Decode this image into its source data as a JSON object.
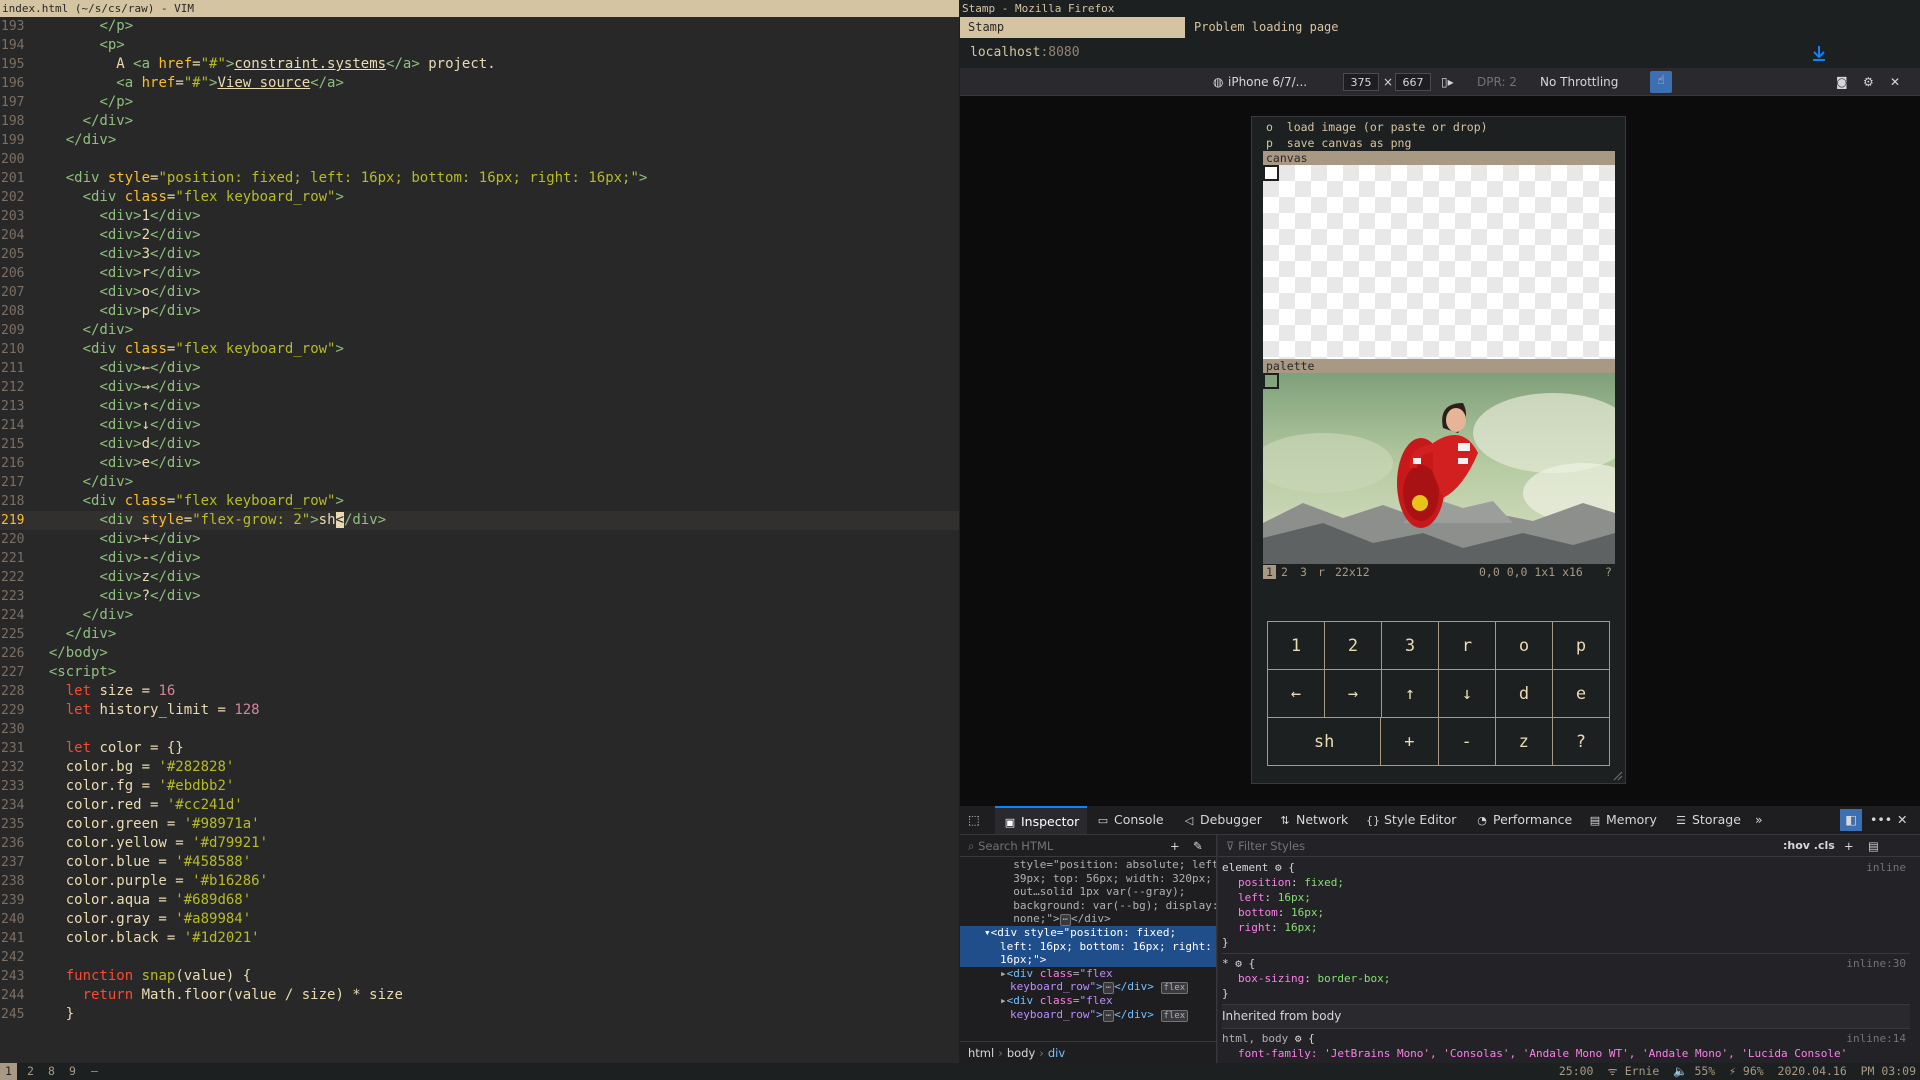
{
  "vim": {
    "title": "index.html (~/s/cs/raw) - VIM"
  },
  "firefox": {
    "title": "Stamp - Mozilla Firefox",
    "tabs": [
      {
        "label": "Stamp"
      },
      {
        "label": "Problem loading page"
      }
    ],
    "url_host": "localhost",
    "url_port": ":8080",
    "rdm": {
      "device": "iPhone 6/7/...",
      "width": "375",
      "x": "×",
      "height": "667",
      "dpr": "DPR: 2",
      "throttling": "No Throttling"
    },
    "page": {
      "help_lines": [
        "o  load image (or paste or drop)",
        "p  save canvas as png"
      ],
      "canvas_label": "canvas",
      "palette_label": "palette",
      "palette_bar": {
        "b1": "1",
        "b2": "2",
        "b3": "3",
        "br": "r",
        "size": "22x12",
        "coords": "0,0 0,0 1x1 x16",
        "help": "?"
      },
      "keyboard": [
        [
          "1",
          "2",
          "3",
          "r",
          "o",
          "p"
        ],
        [
          "←",
          "→",
          "↑",
          "↓",
          "d",
          "e"
        ],
        [
          "sh",
          "+",
          "-",
          "z",
          "?"
        ]
      ]
    }
  },
  "devtools": {
    "tabs": {
      "inspector": "Inspector",
      "console": "Console",
      "debugger": "Debugger",
      "network": "Network",
      "style_editor": "Style Editor",
      "performance": "Performance",
      "memory": "Memory",
      "storage": "Storage"
    },
    "search_placeholder": "Search HTML",
    "filter_placeholder": "Filter Styles",
    "hov_cls": ":hov .cls",
    "breadcrumbs": [
      "html",
      "body",
      "div"
    ],
    "inherited_label": "Inherited from body",
    "rule1": {
      "selector": "element",
      "source": "inline"
    },
    "rule2": {
      "selector": "*",
      "source": "inline:30",
      "prop": "box-sizing",
      "value": "border-box;"
    },
    "rule3": {
      "selector": "html, body",
      "source": "inline:14"
    }
  },
  "statusbar": {
    "workspaces": [
      "1",
      "2",
      "8",
      "9",
      "–"
    ],
    "right": "25:00  ᯤ Ernie  🔈 55%  ⚡ 96%  2020.04.16  PM 03:09"
  }
}
